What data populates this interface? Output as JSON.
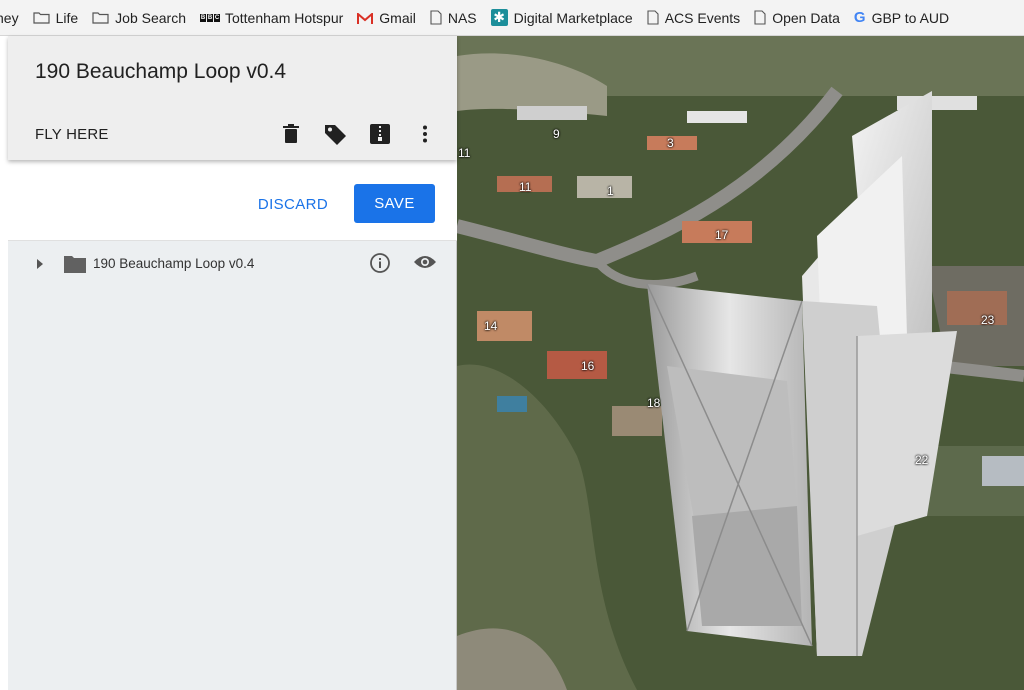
{
  "bookmarks": [
    {
      "label": "ney",
      "icon": "none"
    },
    {
      "label": "Life",
      "icon": "folder-icon"
    },
    {
      "label": "Job Search",
      "icon": "folder-icon"
    },
    {
      "label": "Tottenham Hotspur",
      "icon": "bbc-icon"
    },
    {
      "label": "Gmail",
      "icon": "gmail-icon"
    },
    {
      "label": "NAS",
      "icon": "page-icon"
    },
    {
      "label": "Digital Marketplace",
      "icon": "marketplace-icon"
    },
    {
      "label": "ACS Events",
      "icon": "page-icon"
    },
    {
      "label": "Open Data",
      "icon": "page-icon"
    },
    {
      "label": "GBP to AUD",
      "icon": "google-icon"
    }
  ],
  "panel": {
    "title": "190 Beauchamp Loop v0.4",
    "fly_here": "FLY HERE",
    "icons": [
      "trash-icon",
      "tag-icon",
      "zip-file-icon",
      "more-vert-icon"
    ],
    "discard_label": "DISCARD",
    "save_label": "SAVE",
    "tree": {
      "label": "190 Beauchamp Loop v0.4",
      "icons": [
        "expand-arrow-icon",
        "folder-icon",
        "info-icon",
        "visibility-icon"
      ]
    }
  },
  "map": {
    "house_labels": [
      "11",
      "9",
      "3",
      "11",
      "1",
      "17",
      "14",
      "16",
      "18",
      "23",
      "22"
    ],
    "colors": {
      "vegetation": "#4b5a3a",
      "road": "#8f8e8a",
      "model": "#d8d8d8",
      "accent": "#1a73e8"
    }
  }
}
